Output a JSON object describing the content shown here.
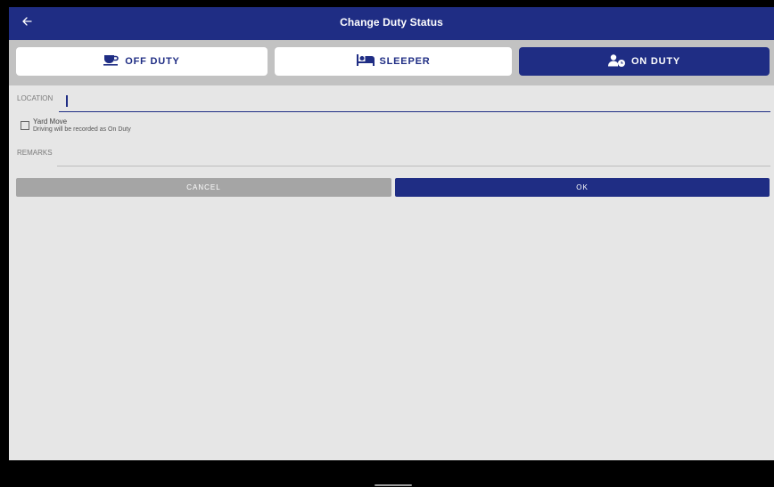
{
  "appbar": {
    "title": "Change Duty Status",
    "back_icon": "arrow-left-icon"
  },
  "duty_status": {
    "selected": "on_duty",
    "buttons": [
      {
        "id": "off_duty",
        "label": "OFF DUTY",
        "icon": "coffee-cup-icon"
      },
      {
        "id": "sleeper",
        "label": "SLEEPER",
        "icon": "bed-icon"
      },
      {
        "id": "on_duty",
        "label": "ON DUTY",
        "icon": "person-clock-icon"
      }
    ]
  },
  "location": {
    "label": "LOCATION",
    "value": ""
  },
  "yard_move": {
    "checked": false,
    "title": "Yard Move",
    "subtitle": "Driving will be recorded as On Duty"
  },
  "remarks": {
    "label": "REMARKS",
    "value": ""
  },
  "actions": {
    "cancel_label": "CANCEL",
    "ok_label": "OK"
  },
  "colors": {
    "primary": "#1f2d84",
    "background": "#e6e6e6",
    "status_bar": "#c2c2c2",
    "cancel_button": "#a5a5a5",
    "white": "#ffffff"
  }
}
